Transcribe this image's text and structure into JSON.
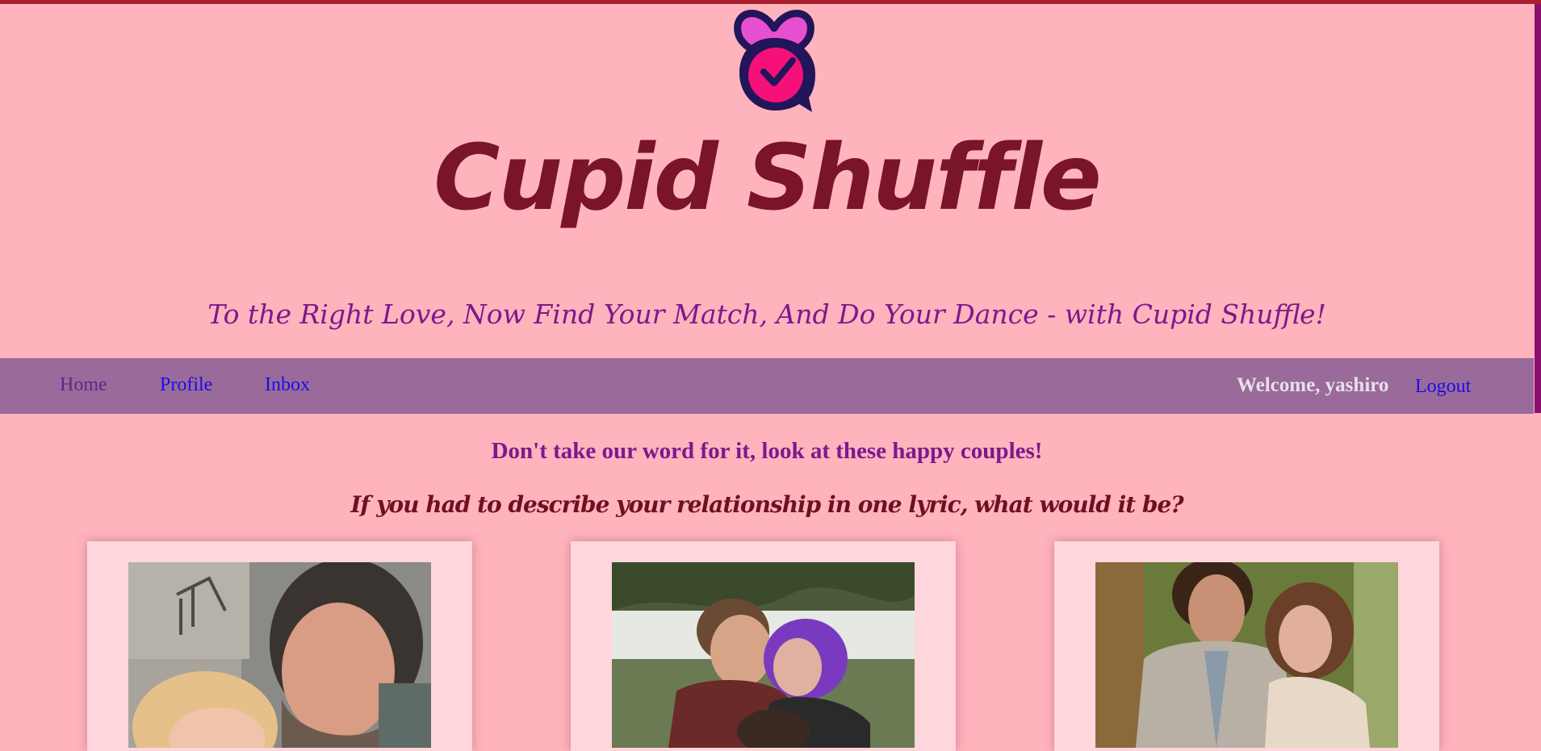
{
  "site": {
    "title": "Cupid Shuffle",
    "tagline": "To the Right Love, Now Find Your Match, And Do Your Dance - with Cupid Shuffle!"
  },
  "nav": {
    "items": [
      {
        "label": "Home"
      },
      {
        "label": "Profile"
      },
      {
        "label": "Inbox"
      }
    ],
    "welcome": "Welcome, yashiro",
    "logout": "Logout"
  },
  "main": {
    "headline": "Don't take our word for it, look at these happy couples!",
    "subheadline": "If you had to describe your relationship in one lyric, what would it be?"
  },
  "colors": {
    "background": "#ffb3bd",
    "navbar": "#9a6a9a",
    "title": "#7a1428",
    "accent": "#7a1a8c"
  },
  "icons": {
    "logo": "heart-clock-chat-logo-icon"
  }
}
